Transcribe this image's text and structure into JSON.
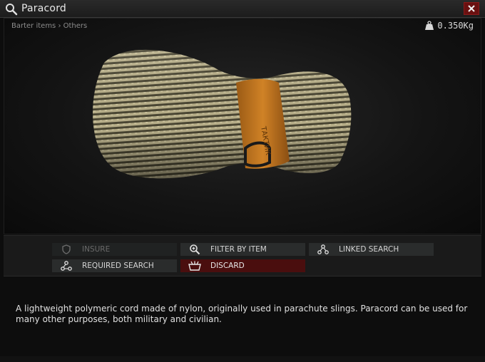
{
  "window": {
    "title": "Paracord",
    "close_label": "×"
  },
  "viewer": {
    "breadcrumb": "Barter items › Others",
    "weight": "0.350Kg"
  },
  "actions": {
    "insure": "INSURE",
    "filter_by_item": "FILTER BY ITEM",
    "linked_search": "LINKED SEARCH",
    "required_search": "REQUIRED SEARCH",
    "discard": "DISCARD"
  },
  "description": "A lightweight polymeric cord made of nylon, originally used in parachute slings. Paracord can be used for many other purposes, both military and civilian.",
  "colors": {
    "discard_bg": "#4a0e0e",
    "close_bg": "#6a1010",
    "cord": "#b9b08a",
    "strap": "#c57a22"
  }
}
